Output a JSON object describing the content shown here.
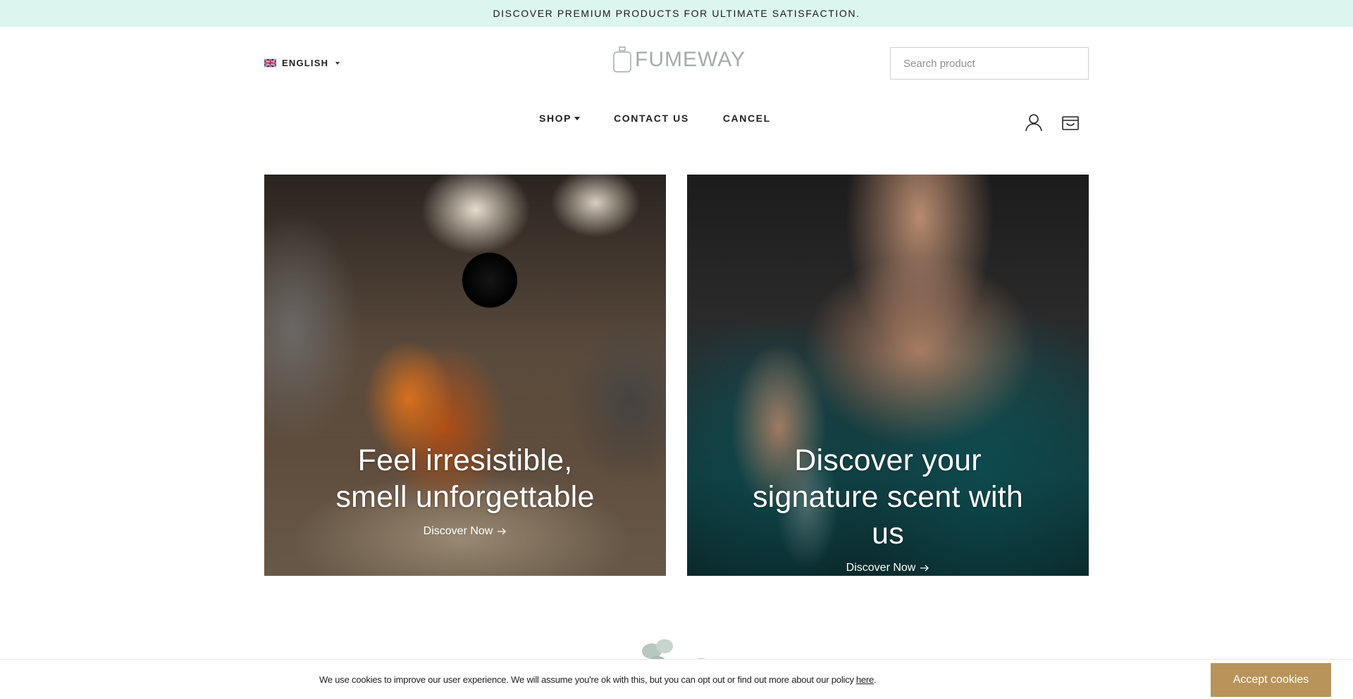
{
  "announcement": {
    "text": "DISCOVER PREMIUM PRODUCTS FOR ULTIMATE SATISFACTION."
  },
  "language": {
    "label": "ENGLISH",
    "flag_icon": "uk-flag-icon"
  },
  "logo": {
    "text": "FUMEWAY",
    "icon": "perfume-bottle-icon"
  },
  "search": {
    "placeholder": "Search product",
    "value": ""
  },
  "nav": {
    "items": [
      {
        "label": "SHOP",
        "has_dropdown": true
      },
      {
        "label": "CONTACT US",
        "has_dropdown": false
      },
      {
        "label": "CANCEL",
        "has_dropdown": false
      }
    ]
  },
  "header_icons": {
    "account": "user-icon",
    "cart": "shopping-bag-icon"
  },
  "banners": [
    {
      "title": "Feel irresistible, smell unforgettable",
      "cta": "Discover Now",
      "cta_icon": "arrow-right-icon"
    },
    {
      "title": "Discover your signature scent with us",
      "cta": "Discover Now",
      "cta_icon": "arrow-right-icon"
    }
  ],
  "cookie": {
    "text": "We use cookies to improve our user experience. We will assume you're ok with this, but you can opt out or find out more about our policy",
    "link_text": "here",
    "suffix": ".",
    "button": "Accept cookies"
  },
  "colors": {
    "announcement_bg": "#dcf5ef",
    "accent_button": "#b8935a",
    "logo": "#a5abab"
  }
}
